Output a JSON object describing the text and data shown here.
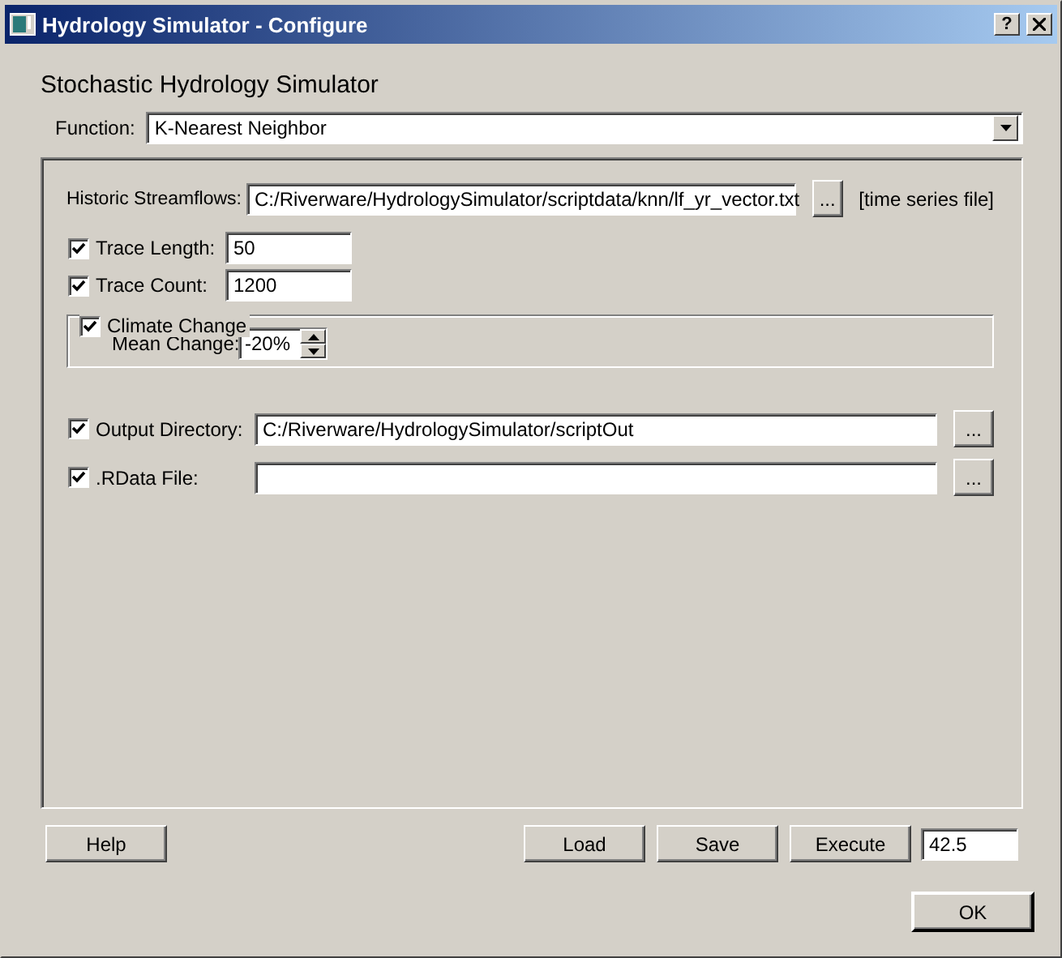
{
  "window": {
    "title": "Hydrology Simulator - Configure",
    "help_button": "?"
  },
  "heading": "Stochastic Hydrology Simulator",
  "function": {
    "label": "Function:",
    "value": "K-Nearest Neighbor"
  },
  "historic_streamflows": {
    "label": "Historic Streamflows:",
    "value": "C:/Riverware/HydrologySimulator/scriptdata/knn/lf_yr_vector.txt",
    "browse": "...",
    "hint": "[time series file]"
  },
  "trace_fields": [
    {
      "label": "Trace Length:",
      "checked": true,
      "value": "50"
    },
    {
      "label": "Trace Count:",
      "checked": true,
      "value": "1200"
    }
  ],
  "climate_change": {
    "label": "Climate Change",
    "checked": true,
    "mean_change": {
      "label": "Mean Change:",
      "value": "-20%"
    }
  },
  "path_fields": [
    {
      "label": "Output Directory:",
      "checked": true,
      "value": "C:/Riverware/HydrologySimulator/scriptOut",
      "browse": "..."
    },
    {
      "label": ".RData File:",
      "checked": true,
      "browse": "..."
    }
  ],
  "help": "Help",
  "actions": [
    "Load",
    "Save",
    "Execute"
  ],
  "result": "42.5",
  "ok": "OK"
}
